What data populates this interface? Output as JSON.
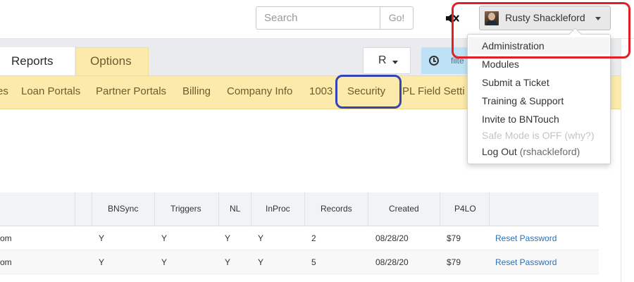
{
  "header": {
    "search_placeholder": "Search",
    "go_label": "Go!",
    "mute_icon": "volume-mute-icon",
    "user_name": "Rusty Shackleford"
  },
  "tabs": {
    "reports": "Reports",
    "options": "Options",
    "r_dropdown": "R",
    "filter_partial": "filte"
  },
  "options_nav": [
    "es",
    "Loan Portals",
    "Partner Portals",
    "Billing",
    "Company Info",
    "1003",
    "Security",
    "PL Field Setti"
  ],
  "table": {
    "headers": [
      "BNSync",
      "Triggers",
      "NL",
      "InProc",
      "Records",
      "Created",
      "P4LO"
    ],
    "rows": [
      {
        "email_tail": "om",
        "bnsync": "Y",
        "triggers": "Y",
        "nl": "Y",
        "inproc": "Y",
        "records": "2",
        "created": "08/28/20",
        "p4lo": "$79",
        "action": "Reset Password"
      },
      {
        "email_tail": "om",
        "bnsync": "Y",
        "triggers": "Y",
        "nl": "Y",
        "inproc": "Y",
        "records": "5",
        "created": "08/28/20",
        "p4lo": "$79",
        "action": "Reset Password"
      }
    ]
  },
  "user_menu": {
    "items": [
      "Administration",
      "Modules",
      "Submit a Ticket",
      "Training & Support",
      "Invite to BNTouch",
      "Safe Mode is OFF (why?)"
    ],
    "logout_label": "Log Out",
    "logout_user": "(rshackleford)"
  },
  "colors": {
    "highlight_red": "#e02026",
    "highlight_blue": "#3443b5",
    "options_yellow": "#fbeaa9",
    "link_blue": "#2c6fb8"
  }
}
